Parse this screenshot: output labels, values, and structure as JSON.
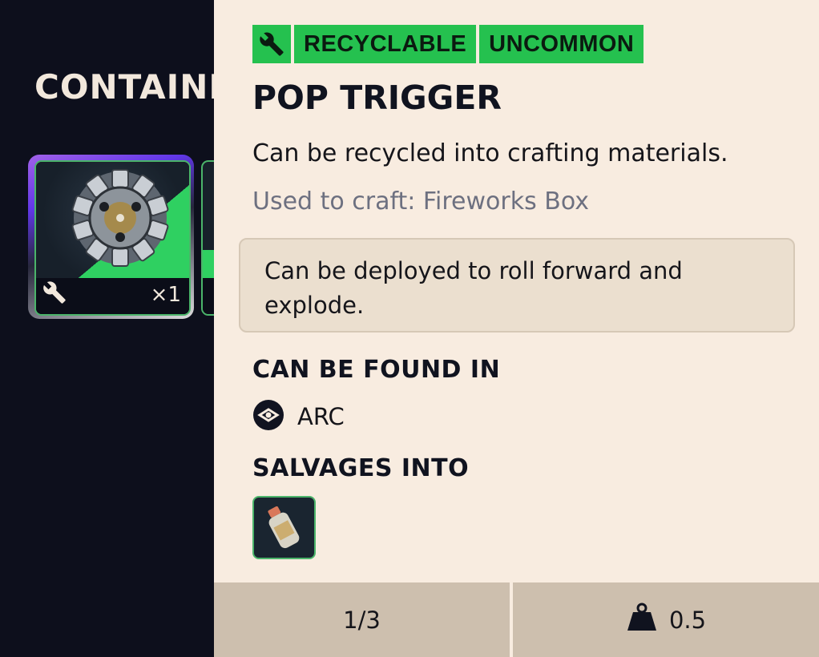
{
  "background": {
    "section_title": "CONTAINI",
    "slot": {
      "quantity": "×1"
    }
  },
  "tooltip": {
    "tags": [
      "RECYCLABLE",
      "UNCOMMON"
    ],
    "title": "POP TRIGGER",
    "description": "Can be recycled into crafting materials.",
    "used_to_craft": "Used to craft: Fireworks Box",
    "flavor_text": "Can be deployed to roll forward and explode.",
    "found_in_heading": "CAN BE FOUND IN",
    "found_in": [
      {
        "label": "ARC",
        "icon": "arc-icon"
      }
    ],
    "salvages_heading": "SALVAGES INTO",
    "footer": {
      "page": "1/3",
      "weight": "0.5"
    }
  },
  "colors": {
    "tag_green": "#25c14f",
    "panel_bg": "#f8ece0",
    "footer_bg": "#cdbfae",
    "rarity_border": "#4bb46a"
  }
}
